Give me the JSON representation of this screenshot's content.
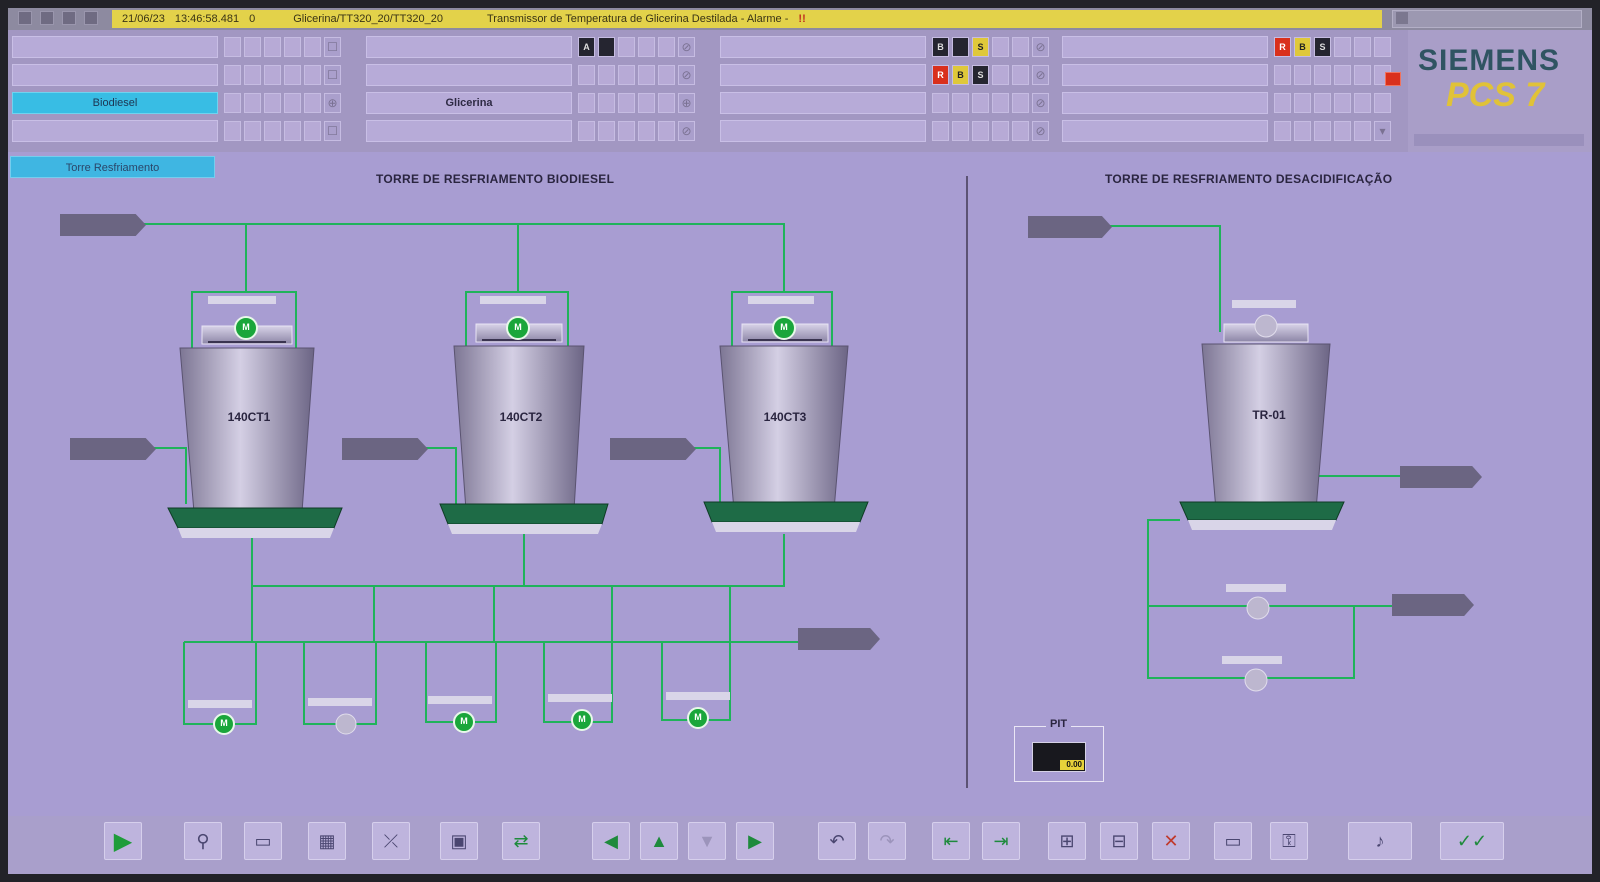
{
  "alarm": {
    "date": "21/06/23",
    "time": "13:46:58.481",
    "number": "0",
    "source": "Glicerina/TT320_20/TT320_20",
    "message": "Transmissor de Temperatura de Glicerina Destilada - Alarme -",
    "ack_symbol": "!!"
  },
  "overview": {
    "buttons": {
      "g1r3": "Biodiesel",
      "g2r3": "Glicerina"
    },
    "status": {
      "g2r1": [
        "A",
        ""
      ],
      "g3r1": [
        "B",
        "",
        "S"
      ],
      "g3r2": [
        "R",
        "B",
        "S"
      ],
      "g4r1": [
        "R",
        "B",
        "S"
      ]
    }
  },
  "logo": {
    "brand": "SIEMENS",
    "product": "PCS 7"
  },
  "canvas": {
    "breadcrumb": "Torre Resfriamento",
    "titles": {
      "left": "TORRE DE RESFRIAMENTO BIODIESEL",
      "right": "TORRE DE RESFRIAMENTO DESACIDIFICAÇÃO"
    },
    "towers": [
      {
        "id": "140CT1",
        "motor": "M"
      },
      {
        "id": "140CT2",
        "motor": "M"
      },
      {
        "id": "140CT3",
        "motor": "M"
      },
      {
        "id": "TR-01",
        "motor": ""
      }
    ],
    "pumps": [
      "M",
      "",
      "M",
      "M",
      "M"
    ],
    "pit": {
      "label": "PIT",
      "value": "0.00"
    }
  },
  "colors": {
    "pipe": "#1fb35a",
    "motor_running": "#1aa63b",
    "motor_stopped": "#bdb7cf",
    "tower_base": "#1e6b46",
    "alarm_line": "#e3d24a",
    "active_area": "#38bde4"
  },
  "toolbar": {
    "icons": [
      "play-icon",
      "pin-icon",
      "folder-icon",
      "picture-icon",
      "trend-icon",
      "faceplate-icon",
      "swap-icon",
      "arrow-left-icon",
      "arrow-up-icon",
      "arrow-down-icon",
      "arrow-right-icon",
      "undo-icon",
      "redo-icon",
      "prev-picture-icon",
      "next-picture-icon",
      "open-file-icon",
      "save-file-icon",
      "delete-icon",
      "monitor-icon",
      "key-icon",
      "audio-icon",
      "ack-icon"
    ]
  }
}
